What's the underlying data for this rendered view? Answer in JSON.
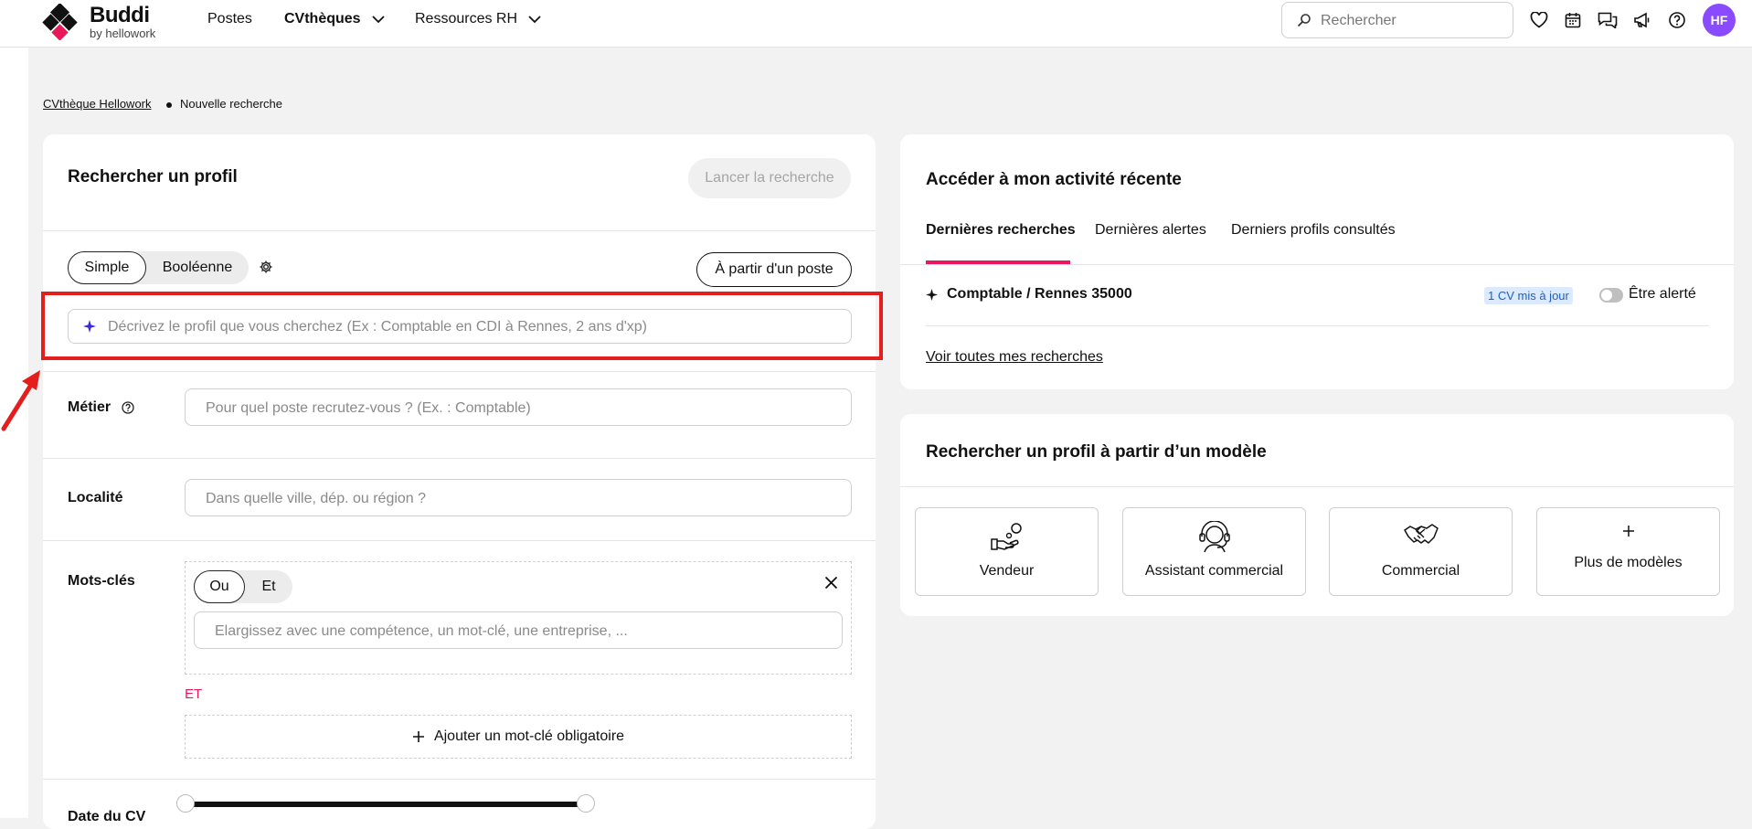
{
  "header": {
    "brand": "Buddi",
    "brand_sub": "by hellowork",
    "nav": [
      "Postes",
      "CVthèques",
      "Ressources RH"
    ],
    "search_placeholder": "Rechercher",
    "avatar_initials": "HF",
    "accent_color": "#8a4bff"
  },
  "breadcrumb": {
    "parent": "CVthèque Hellowork",
    "current": "Nouvelle recherche"
  },
  "search_panel": {
    "title": "Rechercher un profil",
    "launch_button": "Lancer la recherche",
    "mode_options": [
      "Simple",
      "Booléenne"
    ],
    "mode_selected": "Simple",
    "from_job_button": "À partir d'un poste",
    "ai_placeholder": "Décrivez le profil que vous cherchez (Ex : Comptable en CDI à Rennes, 2 ans d'xp)",
    "metier_label": "Métier",
    "metier_placeholder": "Pour quel poste recrutez-vous ? (Ex. : Comptable)",
    "localite_label": "Localité",
    "localite_placeholder": "Dans quelle ville, dép. ou région ?",
    "motscles_label": "Mots-clés",
    "logic_options": [
      "Ou",
      "Et"
    ],
    "logic_selected": "Ou",
    "keyword_placeholder": "Elargissez avec une compétence, un mot-clé, une entreprise, ...",
    "and_label": "ET",
    "add_keyword": "Ajouter un mot-clé obligatoire",
    "date_label": "Date du CV"
  },
  "activity_panel": {
    "title": "Accéder à mon activité récente",
    "tabs": [
      "Dernières recherches",
      "Dernières alertes",
      "Derniers profils consultés"
    ],
    "active_tab": "Dernières recherches",
    "recent_search": "Comptable / Rennes 35000",
    "recent_badge": "1 CV mis à jour",
    "alert_toggle_label": "Être alerté",
    "see_all": "Voir toutes mes recherches",
    "tab_underline_color": "#e8195a"
  },
  "templates_panel": {
    "title": "Rechercher un profil à partir d’un modèle",
    "cards": [
      {
        "label": "Vendeur",
        "icon": "hand-coins-icon"
      },
      {
        "label": "Assistant commercial",
        "icon": "headset-icon"
      },
      {
        "label": "Commercial",
        "icon": "handshake-icon"
      },
      {
        "label": "Plus de modèles",
        "icon": "plus-icon"
      }
    ]
  },
  "annotation": {
    "highlight_color": "#e41d1d"
  }
}
